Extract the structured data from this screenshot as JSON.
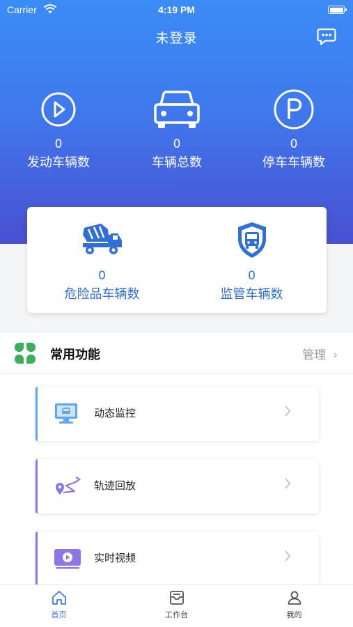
{
  "status_bar": {
    "carrier": "Carrier",
    "time": "4:19 PM"
  },
  "header": {
    "title": "未登录"
  },
  "stats": [
    {
      "icon": "play-circle-icon",
      "value": "0",
      "label": "发动车辆数"
    },
    {
      "icon": "car-icon",
      "value": "0",
      "label": "车辆总数"
    },
    {
      "icon": "parking-icon",
      "value": "0",
      "label": "停车车辆数"
    }
  ],
  "summary_card": [
    {
      "icon": "mixer-truck-icon",
      "value": "0",
      "label": "危险品车辆数"
    },
    {
      "icon": "shield-bus-icon",
      "value": "0",
      "label": "监管车辆数"
    }
  ],
  "section": {
    "title": "常用功能",
    "manage_label": "管理",
    "icon": "clover-icon"
  },
  "functions": [
    {
      "icon": "monitor-icon",
      "label": "动态监控",
      "accent": "#5fa8ef"
    },
    {
      "icon": "route-icon",
      "label": "轨迹回放",
      "accent": "#8f76e6"
    },
    {
      "icon": "video-icon",
      "label": "实时视频",
      "accent": "#8f76e6"
    }
  ],
  "tabbar": [
    {
      "icon": "home-icon",
      "label": "首页",
      "active": true
    },
    {
      "icon": "workbench-icon",
      "label": "工作台",
      "active": false
    },
    {
      "icon": "user-icon",
      "label": "我的",
      "active": false
    }
  ],
  "colors": {
    "primary": "#3b7bef",
    "hero_top": "#3b8cf7",
    "hero_bottom": "#4a4fd0",
    "clover": "#3fae5a"
  }
}
